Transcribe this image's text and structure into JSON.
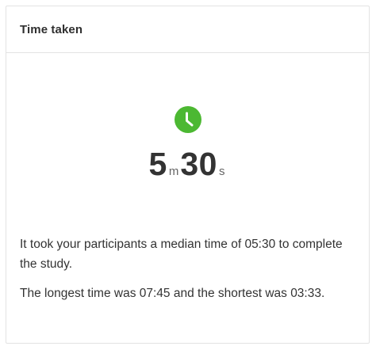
{
  "card": {
    "title": "Time taken"
  },
  "icon": "clock-icon",
  "accent_color": "#4cb832",
  "duration": {
    "minutes": "5",
    "minutes_unit": "m",
    "seconds": "30",
    "seconds_unit": "s"
  },
  "summary": {
    "median_text": "It took your participants a median time of 05:30 to complete the study.",
    "range_text": "The longest time was 07:45 and the shortest was 03:33."
  }
}
